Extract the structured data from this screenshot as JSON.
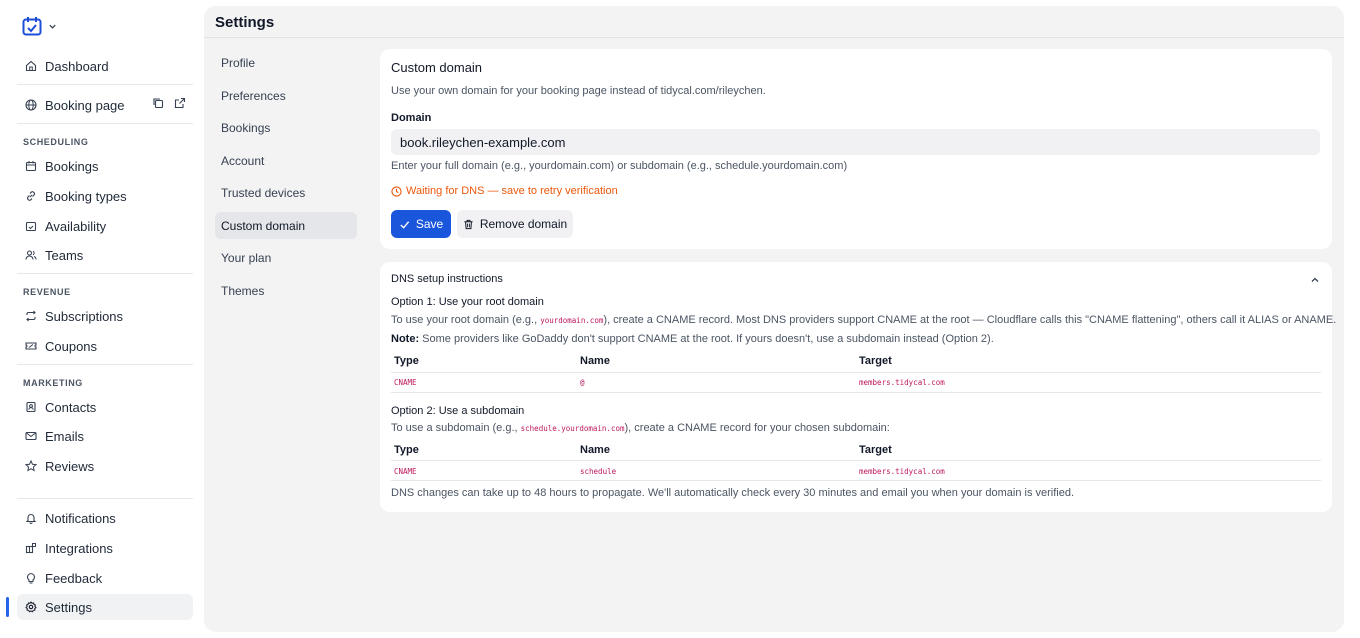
{
  "sidebar": {
    "items": {
      "dashboard": "Dashboard",
      "booking_page": "Booking page",
      "bookings": "Bookings",
      "booking_types": "Booking types",
      "availability": "Availability",
      "teams": "Teams",
      "subscriptions": "Subscriptions",
      "coupons": "Coupons",
      "contacts": "Contacts",
      "emails": "Emails",
      "reviews": "Reviews",
      "notifications": "Notifications",
      "integrations": "Integrations",
      "feedback": "Feedback",
      "settings": "Settings"
    },
    "sections": {
      "scheduling": "SCHEDULING",
      "revenue": "REVENUE",
      "marketing": "MARKETING"
    }
  },
  "main": {
    "title": "Settings"
  },
  "subnav": [
    "Profile",
    "Preferences",
    "Bookings",
    "Account",
    "Trusted devices",
    "Custom domain",
    "Your plan",
    "Themes"
  ],
  "custom_domain": {
    "title": "Custom domain",
    "description": "Use your own domain for your booking page instead of tidycal.com/rileychen.",
    "domain_label": "Domain",
    "domain_value": "book.rileychen-example.com",
    "hint": "Enter your full domain (e.g., yourdomain.com) or subdomain (e.g., schedule.yourdomain.com)",
    "status": "Waiting for DNS — save to retry verification",
    "save_label": "Save",
    "remove_label": "Remove domain"
  },
  "dns": {
    "title": "DNS setup instructions",
    "option1": {
      "title": "Option 1: Use your root domain",
      "text_before": "To use your root domain (e.g., ",
      "example": "yourdomain.com",
      "text_after": "), create a CNAME record. Most DNS providers support CNAME at the root — Cloudflare calls this \"CNAME flattening\", others call it ALIAS or ANAME.",
      "note_label": "Note:",
      "note_text": " Some providers like GoDaddy don't support CNAME at the root. If yours doesn't, use a subdomain instead (Option 2).",
      "row": {
        "type": "CNAME",
        "name": "@",
        "target": "members.tidycal.com"
      }
    },
    "option2": {
      "title": "Option 2: Use a subdomain",
      "text_before": "To use a subdomain (e.g., ",
      "example": "schedule.yourdomain.com",
      "text_after": "), create a CNAME record for your chosen subdomain:",
      "row": {
        "type": "CNAME",
        "name": "schedule",
        "target": "members.tidycal.com"
      }
    },
    "headers": {
      "type": "Type",
      "name": "Name",
      "target": "Target"
    },
    "footer": "DNS changes can take up to 48 hours to propagate. We'll automatically check every 30 minutes and email you when your domain is verified."
  },
  "colors": {
    "accent": "#1a56db",
    "warning": "#ea580c",
    "code": "#be185d"
  }
}
